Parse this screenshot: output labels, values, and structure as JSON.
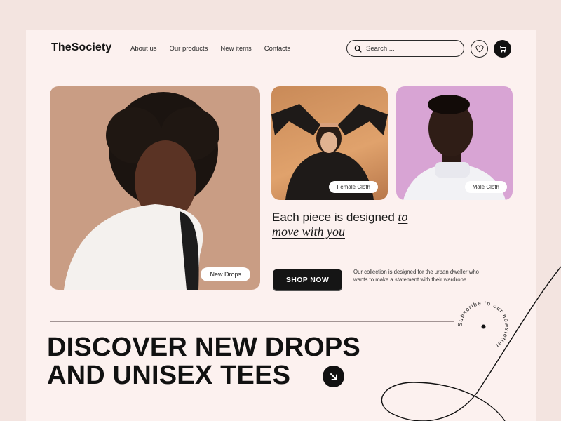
{
  "header": {
    "logo": "TheSociety",
    "nav": [
      "About us",
      "Our products",
      "New items",
      "Contacts"
    ],
    "search_placeholder": "Search ...",
    "icons": [
      "search-icon",
      "heart-icon",
      "cart-icon"
    ]
  },
  "cards": {
    "main_label": "New Drops",
    "female_label": "Female Cloth",
    "male_label": "Male Cloth"
  },
  "tagline": {
    "lead": "Each piece is designed",
    "emph_to": "to",
    "emph_rest": "move with you"
  },
  "cta": {
    "shop_label": "SHOP NOW",
    "blurb": "Our collection is designed for the urban dweller who wants to make a statement with their wardrobe."
  },
  "headline": {
    "line1": "DISCOVER NEW DROPS",
    "line2": "AND UNISEX TEES"
  },
  "newsletter_badge": "Subscribe to our newsletter",
  "colors": {
    "page_bg": "#f3e4e0",
    "panel_bg": "#fcf1ef",
    "ink": "#111111",
    "card_main": "#c99d84",
    "card_female": "#dfa06a",
    "card_male": "#d8a4d4"
  }
}
